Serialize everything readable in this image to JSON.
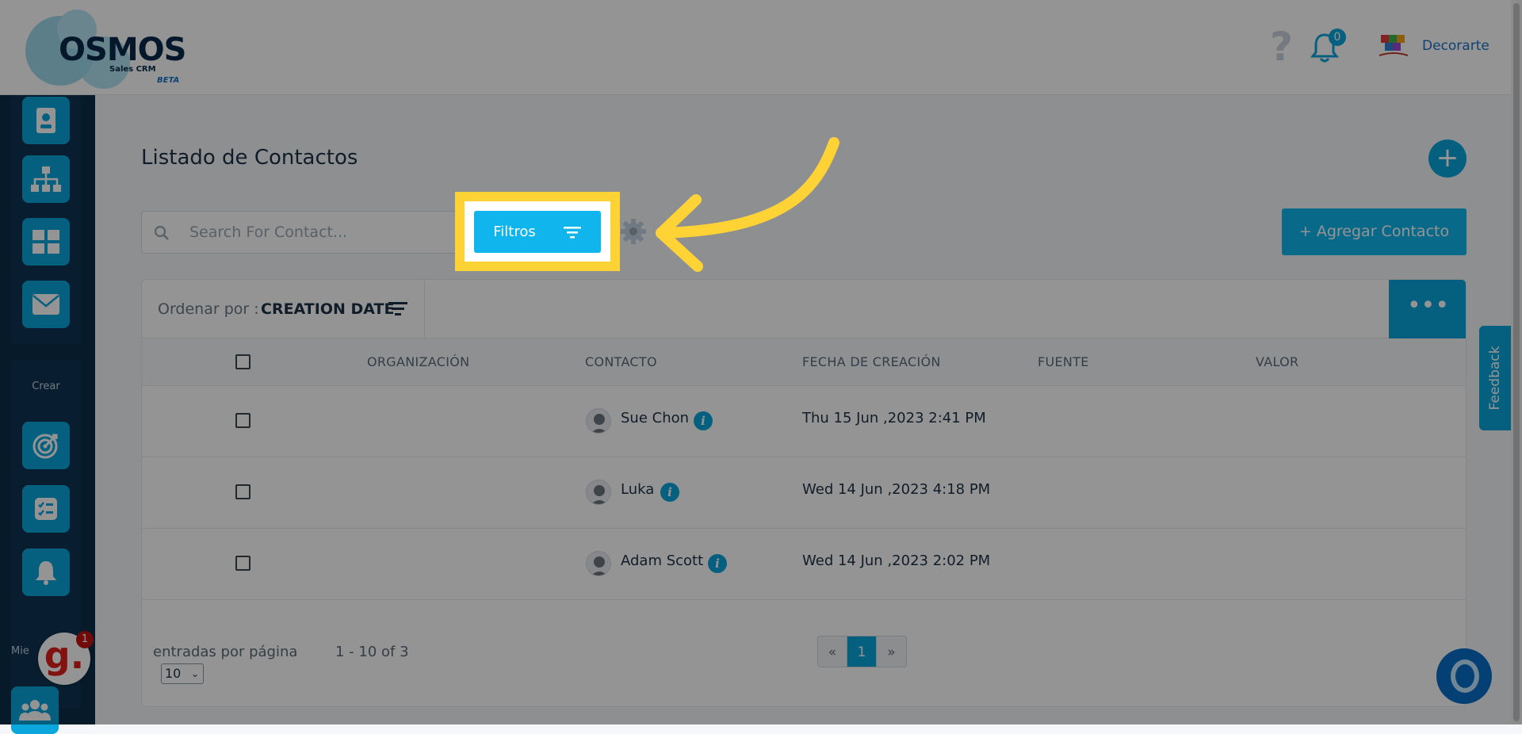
{
  "header": {
    "logo_text": "OSMOS",
    "logo_sub": "Sales CRM",
    "logo_beta": "BETA",
    "help_icon": "?",
    "notification_count": "0",
    "company_name": "Decorarte"
  },
  "sidebar": {
    "crear_label": "Crear",
    "cut_label": "Mie",
    "icons": [
      "contact-card-icon",
      "org-chart-icon",
      "grid-icon",
      "mail-icon",
      "target-icon",
      "checklist-icon",
      "bell-icon",
      "users-icon"
    ]
  },
  "main": {
    "title": "Listado de Contactos",
    "search_placeholder": "Search For Contact...",
    "filters_label": "Filtros",
    "add_contact_label": "+ Agregar Contacto",
    "sort_label": "Ordenar por :",
    "sort_value": "CREATION DATE",
    "more_label": "•••"
  },
  "table": {
    "headers": [
      "ORGANIZACIÓN",
      "CONTACTO",
      "FECHA DE CREACIÓN",
      "FUENTE",
      "VALOR"
    ],
    "rows": [
      {
        "contact": "Sue Chon",
        "date": "Thu 15 Jun ,2023 2:41 PM"
      },
      {
        "contact": "Luka",
        "date": "Wed 14 Jun ,2023 4:18 PM"
      },
      {
        "contact": "Adam Scott",
        "date": "Wed 14 Jun ,2023 2:02 PM"
      }
    ]
  },
  "footer": {
    "per_page_label": "entradas por página",
    "per_page_value": "10",
    "range_text": "1 - 10 of 3",
    "pager": [
      "«",
      "1",
      "»"
    ]
  },
  "floating": {
    "feedback_label": "Feedback",
    "g_badge": "g.",
    "g_count": "1"
  },
  "colors": {
    "accent": "#0aa6dc",
    "button": "#0fb5ec",
    "sidebar": "#0b2d48",
    "highlight": "#ffd236"
  }
}
